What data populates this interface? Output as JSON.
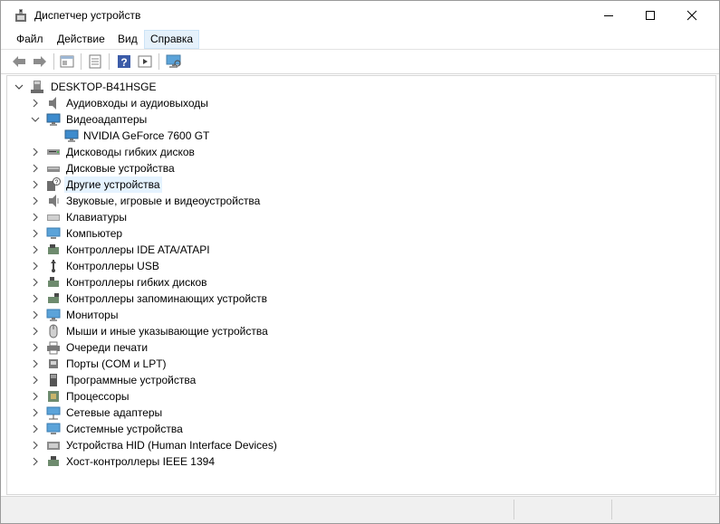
{
  "window": {
    "title": "Диспетчер устройств"
  },
  "menu": [
    "Файл",
    "Действие",
    "Вид",
    "Справка"
  ],
  "toolbar_icons": [
    "back-arrow-icon",
    "forward-arrow-icon",
    "properties-icon",
    "device-list-icon",
    "help-icon",
    "run-icon",
    "monitor-scan-icon"
  ],
  "tree": {
    "root": "DESKTOP-B41HSGE",
    "items": [
      {
        "label": "Аудиовходы и аудиовыходы",
        "icon": "speaker-icon",
        "expanded": false
      },
      {
        "label": "Видеоадаптеры",
        "icon": "display-adapter-icon",
        "expanded": true,
        "children": [
          "NVIDIA GeForce 7600 GT"
        ]
      },
      {
        "label": "Дисководы гибких дисков",
        "icon": "floppy-drive-icon",
        "expanded": false
      },
      {
        "label": "Дисковые устройства",
        "icon": "disk-drive-icon",
        "expanded": false
      },
      {
        "label": "Другие устройства",
        "icon": "unknown-device-icon",
        "expanded": false,
        "selected": true
      },
      {
        "label": "Звуковые, игровые и видеоустройства",
        "icon": "sound-device-icon",
        "expanded": false
      },
      {
        "label": "Клавиатуры",
        "icon": "keyboard-icon",
        "expanded": false
      },
      {
        "label": "Компьютер",
        "icon": "computer-icon",
        "expanded": false
      },
      {
        "label": "Контроллеры IDE ATA/ATAPI",
        "icon": "ide-controller-icon",
        "expanded": false
      },
      {
        "label": "Контроллеры USB",
        "icon": "usb-icon",
        "expanded": false
      },
      {
        "label": "Контроллеры гибких дисков",
        "icon": "floppy-controller-icon",
        "expanded": false
      },
      {
        "label": "Контроллеры запоминающих устройств",
        "icon": "storage-controller-icon",
        "expanded": false
      },
      {
        "label": "Мониторы",
        "icon": "monitor-icon",
        "expanded": false
      },
      {
        "label": "Мыши и иные указывающие устройства",
        "icon": "mouse-icon",
        "expanded": false
      },
      {
        "label": "Очереди печати",
        "icon": "printer-icon",
        "expanded": false
      },
      {
        "label": "Порты (COM и LPT)",
        "icon": "port-icon",
        "expanded": false
      },
      {
        "label": "Программные устройства",
        "icon": "software-device-icon",
        "expanded": false
      },
      {
        "label": "Процессоры",
        "icon": "processor-icon",
        "expanded": false
      },
      {
        "label": "Сетевые адаптеры",
        "icon": "network-adapter-icon",
        "expanded": false
      },
      {
        "label": "Системные устройства",
        "icon": "system-device-icon",
        "expanded": false
      },
      {
        "label": "Устройства HID (Human Interface Devices)",
        "icon": "hid-icon",
        "expanded": false
      },
      {
        "label": "Хост-контроллеры IEEE 1394",
        "icon": "ieee1394-icon",
        "expanded": false
      }
    ]
  },
  "colors": {
    "selection": "#e5f3ff",
    "menu_active": "#e5f1fb"
  }
}
